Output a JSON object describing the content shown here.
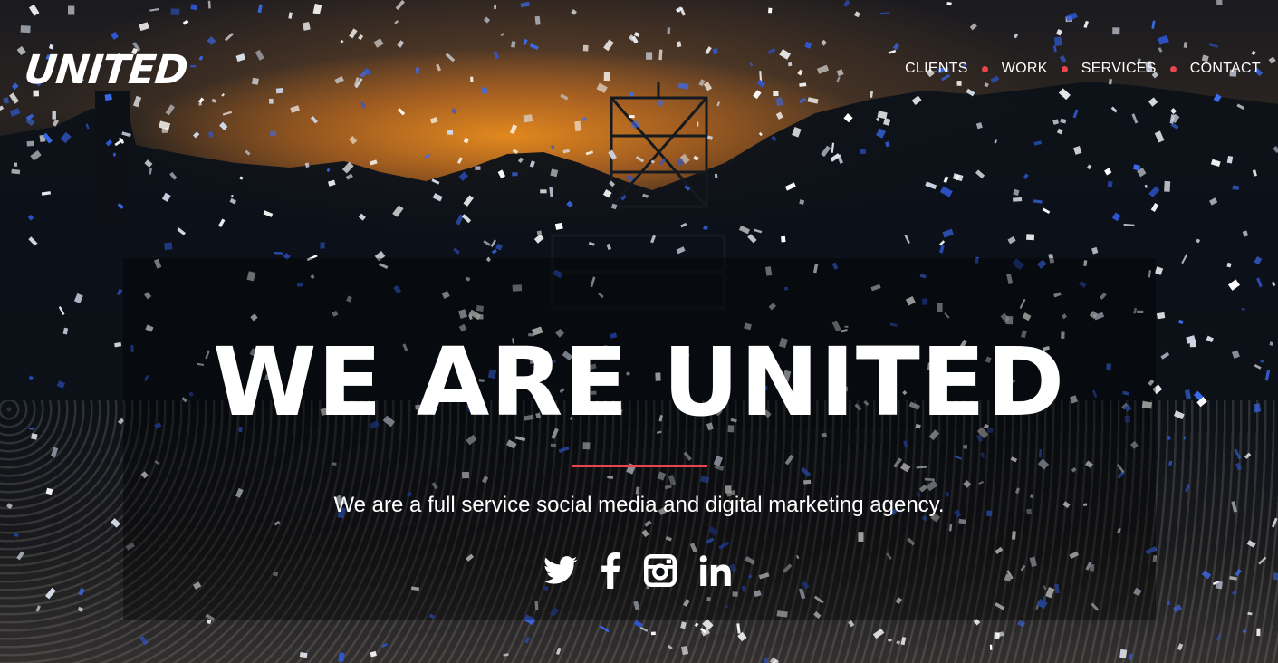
{
  "brand": {
    "logo_text": "UNITED"
  },
  "nav": {
    "items": [
      {
        "label": "CLIENTS"
      },
      {
        "label": "WORK"
      },
      {
        "label": "SERVICES"
      },
      {
        "label": "CONTACT"
      }
    ],
    "separator_color": "#e8454f"
  },
  "hero": {
    "title": "WE ARE UNITED",
    "subtitle": "We are a full service social media and digital marketing agency.",
    "accent_color": "#e8454f"
  },
  "social": {
    "icons": [
      "twitter-icon",
      "facebook-icon",
      "instagram-icon",
      "linkedin-icon"
    ]
  }
}
